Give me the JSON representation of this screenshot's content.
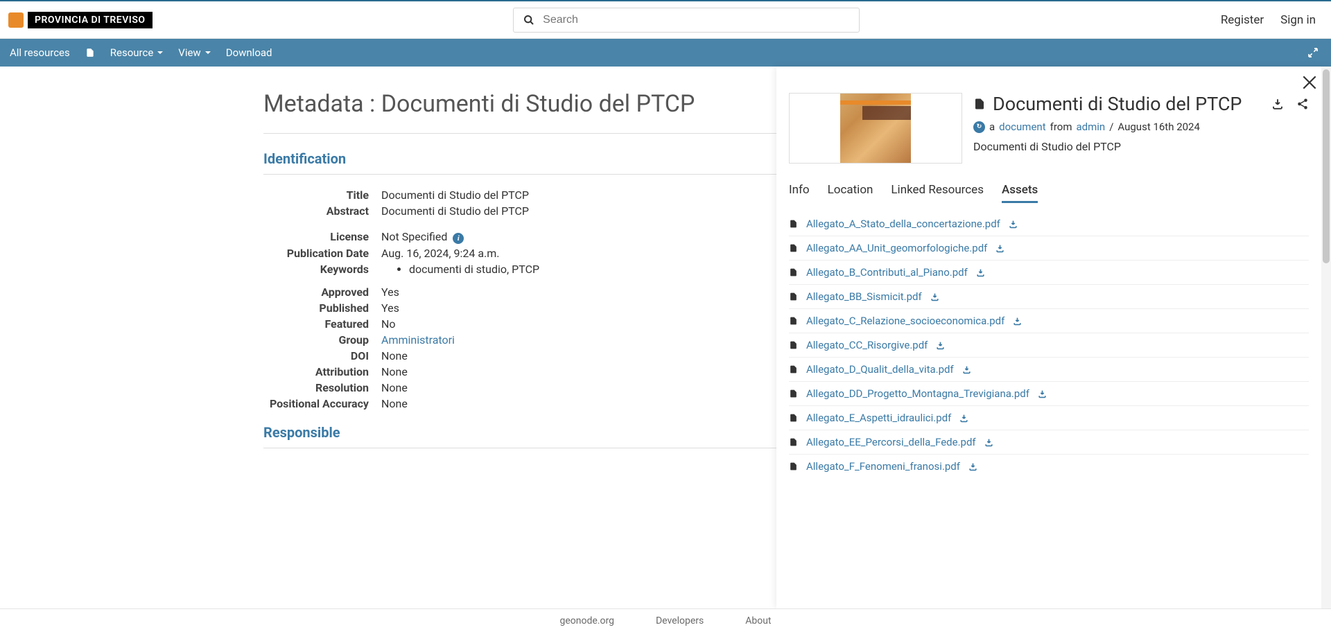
{
  "brand": "PROVINCIA DI TREVISO",
  "search": {
    "placeholder": "Search"
  },
  "topbar": {
    "register": "Register",
    "signin": "Sign in"
  },
  "nav": {
    "all_resources": "All resources",
    "resource": "Resource",
    "view": "View",
    "download": "Download"
  },
  "page_title": "Metadata : Documenti di Studio del PTCP",
  "sections": {
    "identification": "Identification",
    "responsible": "Responsible"
  },
  "meta": {
    "labels": {
      "title": "Title",
      "abstract": "Abstract",
      "license": "License",
      "publication_date": "Publication Date",
      "keywords": "Keywords",
      "approved": "Approved",
      "published": "Published",
      "featured": "Featured",
      "group": "Group",
      "doi": "DOI",
      "attribution": "Attribution",
      "resolution": "Resolution",
      "positional_accuracy": "Positional Accuracy"
    },
    "values": {
      "title": "Documenti di Studio del PTCP",
      "abstract": "Documenti di Studio del PTCP",
      "license": "Not Specified",
      "publication_date": "Aug. 16, 2024, 9:24 a.m.",
      "keywords": "documenti di studio, PTCP",
      "approved": "Yes",
      "published": "Yes",
      "featured": "No",
      "group": "Amministratori",
      "doi": "None",
      "attribution": "None",
      "resolution": "None",
      "positional_accuracy": "None"
    }
  },
  "panel": {
    "title": "Documenti di Studio del PTCP",
    "a": "a",
    "type": "document",
    "from": "from",
    "user": "admin",
    "sep": "/",
    "date": "August 16th 2024",
    "desc": "Documenti di Studio del PTCP",
    "tabs": {
      "info": "Info",
      "location": "Location",
      "linked": "Linked Resources",
      "assets": "Assets"
    },
    "assets": [
      "Allegato_A_Stato_della_concertazione.pdf",
      "Allegato_AA_Unit_geomorfologiche.pdf",
      "Allegato_B_Contributi_al_Piano.pdf",
      "Allegato_BB_Sismicit.pdf",
      "Allegato_C_Relazione_socioeconomica.pdf",
      "Allegato_CC_Risorgive.pdf",
      "Allegato_D_Qualit_della_vita.pdf",
      "Allegato_DD_Progetto_Montagna_Trevigiana.pdf",
      "Allegato_E_Aspetti_idraulici.pdf",
      "Allegato_EE_Percorsi_della_Fede.pdf",
      "Allegato_F_Fenomeni_franosi.pdf"
    ]
  },
  "footer": {
    "geonode": "geonode.org",
    "developers": "Developers",
    "about": "About"
  }
}
